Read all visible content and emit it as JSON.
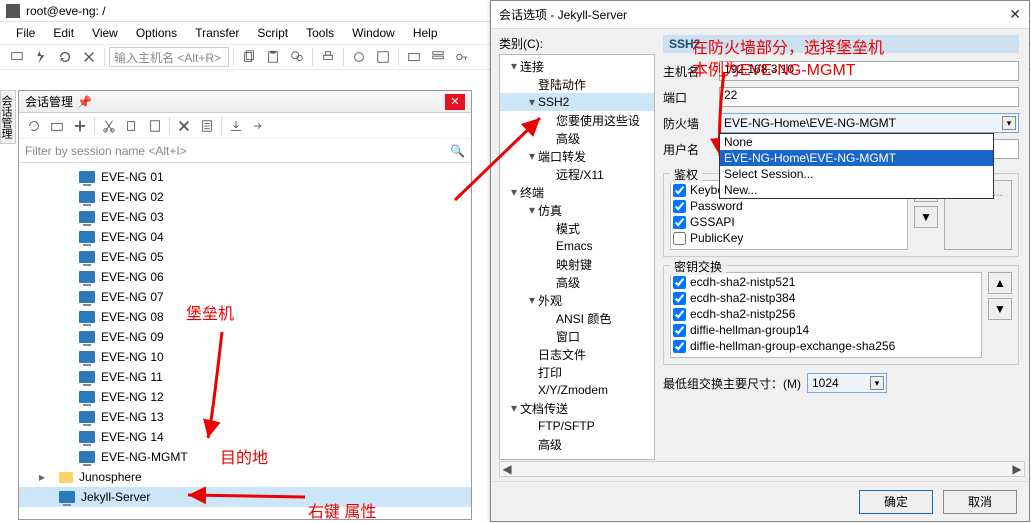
{
  "title": "root@eve-ng: /",
  "menu": {
    "file": "File",
    "edit": "Edit",
    "view": "View",
    "options": "Options",
    "transfer": "Transfer",
    "script": "Script",
    "tools": "Tools",
    "window": "Window",
    "help": "Help"
  },
  "toolbar": {
    "host_placeholder": "输入主机名 <Alt+R>"
  },
  "side_tab": "会话管理",
  "session_panel": {
    "title": "会话管理",
    "filter_placeholder": "Filter by session name <Alt+I>",
    "items": [
      {
        "label": "EVE-NG 01"
      },
      {
        "label": "EVE-NG 02"
      },
      {
        "label": "EVE-NG 03"
      },
      {
        "label": "EVE-NG 04"
      },
      {
        "label": "EVE-NG 05"
      },
      {
        "label": "EVE-NG 06"
      },
      {
        "label": "EVE-NG 07"
      },
      {
        "label": "EVE-NG 08"
      },
      {
        "label": "EVE-NG 09"
      },
      {
        "label": "EVE-NG 10"
      },
      {
        "label": "EVE-NG 11"
      },
      {
        "label": "EVE-NG 12"
      },
      {
        "label": "EVE-NG 13"
      },
      {
        "label": "EVE-NG 14"
      },
      {
        "label": "EVE-NG-MGMT"
      }
    ],
    "folder": "Junosphere",
    "selected": "Jekyll-Server"
  },
  "dialog": {
    "title": "会话选项 - Jekyll-Server",
    "category_label": "类别(C):",
    "cats": {
      "conn": "连接",
      "login": "登陆动作",
      "ssh2": "SSH2",
      "ssh2_hint": "您要使用这些设",
      "adv": "高级",
      "portfwd": "端口转发",
      "remote": "远程/X11",
      "term": "终端",
      "emu": "仿真",
      "mode": "模式",
      "emacs": "Emacs",
      "mapkeys": "映射键",
      "adv2": "高级",
      "appear": "外观",
      "ansi": "ANSI 颜色",
      "window": "窗口",
      "logfile": "日志文件",
      "print": "打印",
      "xyz": "X/Y/Zmodem",
      "filetx": "文档传送",
      "ftp": "FTP/SFTP",
      "adv3": "高级"
    },
    "ssh2": {
      "heading": "SSH2",
      "host_lbl": "主机名",
      "host": "192.168.3.10",
      "port_lbl": "端口",
      "port": "22",
      "firewall_lbl": "防火墙",
      "firewall": "EVE-NG-Home\\EVE-NG-MGMT",
      "fw_opts": {
        "none": "None",
        "mgmt": "EVE-NG-Home\\EVE-NG-MGMT",
        "select": "Select Session...",
        "new": "New..."
      },
      "user_lbl": "用户名",
      "user": "",
      "auth_lbl": "鉴权",
      "auth": {
        "kbd": "Keyboard Interactive",
        "pwd": "Password",
        "gss": "GSSAPI",
        "pk": "PublicKey"
      },
      "prop_btn": "属性(E)...",
      "kex_lbl": "密钥交换",
      "kex": [
        "ecdh-sha2-nistp521",
        "ecdh-sha2-nistp384",
        "ecdh-sha2-nistp256",
        "diffie-hellman-group14",
        "diffie-hellman-group-exchange-sha256"
      ],
      "min_lbl": "最低组交换主要尺寸：(M)",
      "min_val": "1024"
    },
    "ok": "确定",
    "cancel": "取消"
  },
  "annotations": {
    "bastion": "堡垒机",
    "dest": "目的地",
    "rightclick": "右键 属性",
    "note1": "在防火墙部分，选择堡垒机",
    "note2": "本例为EVE-NG-MGMT"
  }
}
